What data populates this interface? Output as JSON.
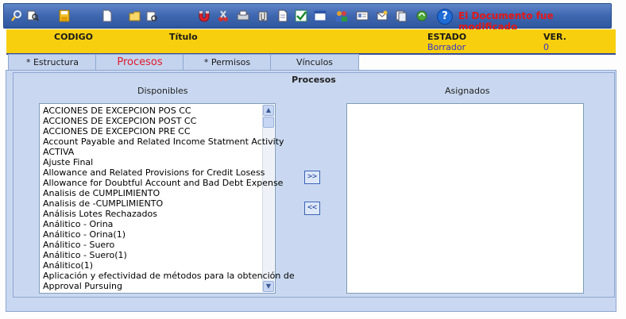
{
  "toolbar": {
    "icons": [
      "search-icon",
      "search-list-icon",
      "save-icon",
      "new-document-icon",
      "open-folder-icon",
      "reload-icon",
      "magnet-icon",
      "cut-icon",
      "print-icon",
      "attach-icon",
      "document-icon",
      "approve-icon",
      "form-icon",
      "users-icon",
      "id-card-icon",
      "email-icon",
      "copy-icon",
      "refresh-icon",
      "help-icon"
    ],
    "help_label": "?",
    "status_message": "El Documento fue modificado",
    "accent": "#3f67b0",
    "status_color": "#e01818"
  },
  "header": {
    "codigo_label": "CODIGO",
    "titulo_label": "Título",
    "estado_label": "ESTADO",
    "estado_value": "Borrador",
    "ver_label": "VER.",
    "ver_value": "0",
    "background": "#f7cf0e"
  },
  "tabs": [
    {
      "label": "* Estructura",
      "active": false
    },
    {
      "label": "Procesos",
      "active": true
    },
    {
      "label": "* Permisos",
      "active": false
    },
    {
      "label": "Vínculos",
      "active": false
    }
  ],
  "procesos": {
    "title": "Procesos",
    "disponibles_label": "Disponibles",
    "asignados_label": "Asignados",
    "add_label": ">>",
    "remove_label": "<<",
    "disponibles": [
      "ACCIONES DE EXCEPCION POS CC",
      "ACCIONES DE EXCEPCION POST CC",
      "ACCIONES DE EXCEPCION PRE CC",
      "Account Payable and Related Income Statment Activity",
      "ACTIVA",
      "Ajuste Final",
      "Allowance and Related Provisions for Credit Losess",
      "Allowance for Doubtful Account and Bad Debt Expense",
      "Analisis de CUMPLIMIENTO",
      "Analisis de -CUMPLIMIENTO",
      "Análisis Lotes Rechazados",
      "Análitico - Orina",
      "Análitico - Orina(1)",
      "Análitico - Suero",
      "Análitico - Suero(1)",
      "Análitico(1)",
      "Aplicación y efectividad de métodos para la obtención de",
      "Approval Pursuing"
    ],
    "asignados": []
  }
}
